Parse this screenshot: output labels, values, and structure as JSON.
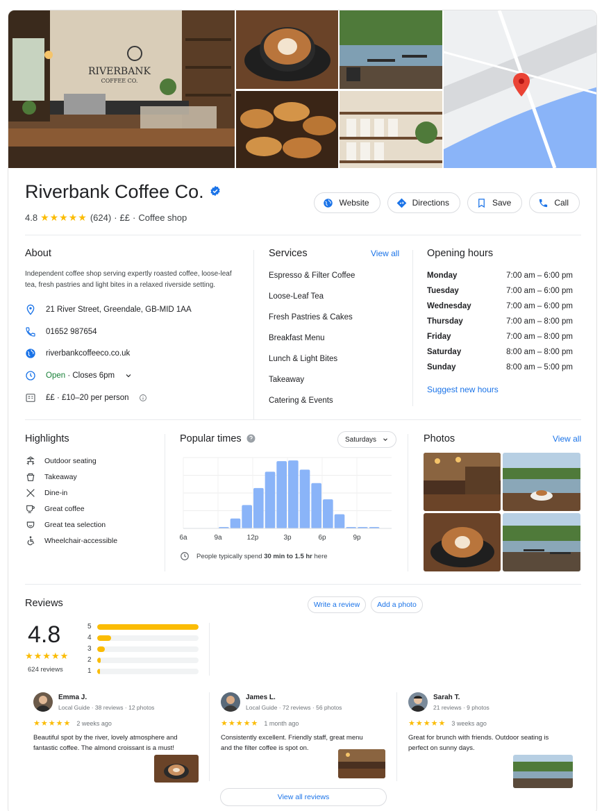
{
  "business": {
    "name": "Riverbank Coffee Co.",
    "rating": "4.8",
    "stars": "★★★★★",
    "review_count": "(624)",
    "price": "££",
    "sep": "·",
    "category": "Coffee shop",
    "logo_line1": "RIVERBANK",
    "logo_line2": "COFFEE CO."
  },
  "actions": {
    "website": "Website",
    "directions": "Directions",
    "save": "Save",
    "call": "Call"
  },
  "about": {
    "title": "About",
    "description": "Independent coffee shop serving expertly roasted coffee, loose-leaf tea, fresh pastries and light bites in a relaxed riverside setting.",
    "address": "21 River Street, Greendale, GB-MID 1AA",
    "phone": "01652 987654",
    "website": "riverbankcoffeeco.co.uk",
    "open_status": "Open",
    "closes": "· Closes 6pm",
    "price_range": "££ · £10–20 per person"
  },
  "services": {
    "title": "Services",
    "view_all": "View all",
    "items": [
      "Espresso & Filter Coffee",
      "Loose-Leaf Tea",
      "Fresh Pastries & Cakes",
      "Breakfast Menu",
      "Lunch & Light Bites",
      "Takeaway",
      "Catering & Events"
    ]
  },
  "hours": {
    "title": "Opening hours",
    "rows": [
      {
        "day": "Monday",
        "time": "7:00 am – 6:00 pm"
      },
      {
        "day": "Tuesday",
        "time": "7:00 am – 6:00 pm"
      },
      {
        "day": "Wednesday",
        "time": "7:00 am – 6:00 pm"
      },
      {
        "day": "Thursday",
        "time": "7:00 am – 8:00 pm"
      },
      {
        "day": "Friday",
        "time": "7:00 am – 8:00 pm"
      },
      {
        "day": "Saturday",
        "time": "8:00 am – 8:00 pm"
      },
      {
        "day": "Sunday",
        "time": "8:00 am – 5:00 pm"
      }
    ],
    "suggest": "Suggest new hours"
  },
  "highlights": {
    "title": "Highlights",
    "items": [
      {
        "label": "Outdoor seating",
        "icon": "outdoor-seating-icon"
      },
      {
        "label": "Takeaway",
        "icon": "takeaway-icon"
      },
      {
        "label": "Dine-in",
        "icon": "dine-in-icon"
      },
      {
        "label": "Great coffee",
        "icon": "coffee-cup-icon"
      },
      {
        "label": "Great tea selection",
        "icon": "tea-icon"
      },
      {
        "label": "Wheelchair-accessible",
        "icon": "wheelchair-icon"
      }
    ]
  },
  "popular_times": {
    "title": "Popular times",
    "day_select": "Saturdays",
    "note_prefix": "People typically spend",
    "note_bold": "30 min to 1.5 hr",
    "note_suffix": "here"
  },
  "chart_data": {
    "type": "bar",
    "x": [
      6,
      7,
      8,
      9,
      10,
      11,
      12,
      13,
      14,
      15,
      16,
      17,
      18,
      19,
      20,
      21,
      22,
      23
    ],
    "values": [
      0,
      0,
      0,
      2,
      14,
      33,
      57,
      80,
      95,
      96,
      83,
      64,
      41,
      20,
      2,
      2,
      2,
      0
    ],
    "tick_labels": [
      "6a",
      "9a",
      "12p",
      "3p",
      "6p",
      "9p"
    ],
    "tick_x": [
      6,
      9,
      12,
      15,
      18,
      21
    ],
    "ylim": [
      0,
      100
    ],
    "color": "#8ab4f8",
    "grid": true
  },
  "photos": {
    "title": "Photos",
    "view_all": "View all"
  },
  "reviews": {
    "title": "Reviews",
    "write": "Write a review",
    "add_photo": "Add a photo",
    "average": "4.8",
    "stars": "★★★★★",
    "total": "624 reviews",
    "distribution": [
      {
        "star": "5",
        "fraction": 1.0
      },
      {
        "star": "4",
        "fraction": 0.14
      },
      {
        "star": "3",
        "fraction": 0.08
      },
      {
        "star": "2",
        "fraction": 0.04
      },
      {
        "star": "1",
        "fraction": 0.03
      }
    ],
    "items": [
      {
        "name": "Emma J.",
        "meta": "Local Guide · 38 reviews · 12 photos",
        "stars": "★★★★★",
        "when": "2 weeks ago",
        "text": "Beautiful spot by the river, lovely atmosphere and fantastic coffee. The almond croissant is a must!"
      },
      {
        "name": "James L.",
        "meta": "Local Guide · 72 reviews · 56 photos",
        "stars": "★★★★★",
        "when": "1 month ago",
        "text": "Consistently excellent. Friendly staff, great menu and the filter coffee is spot on."
      },
      {
        "name": "Sarah T.",
        "meta": "21 reviews · 9 photos",
        "stars": "★★★★★",
        "when": "3 weeks ago",
        "text": "Great for brunch with friends. Outdoor seating is perfect on sunny days."
      }
    ],
    "view_all": "View all reviews"
  },
  "colors": {
    "accent": "#1a73e8",
    "star": "#fbbc04",
    "open": "#188038",
    "map_water": "#8ab4f8",
    "pin": "#ea4335"
  }
}
